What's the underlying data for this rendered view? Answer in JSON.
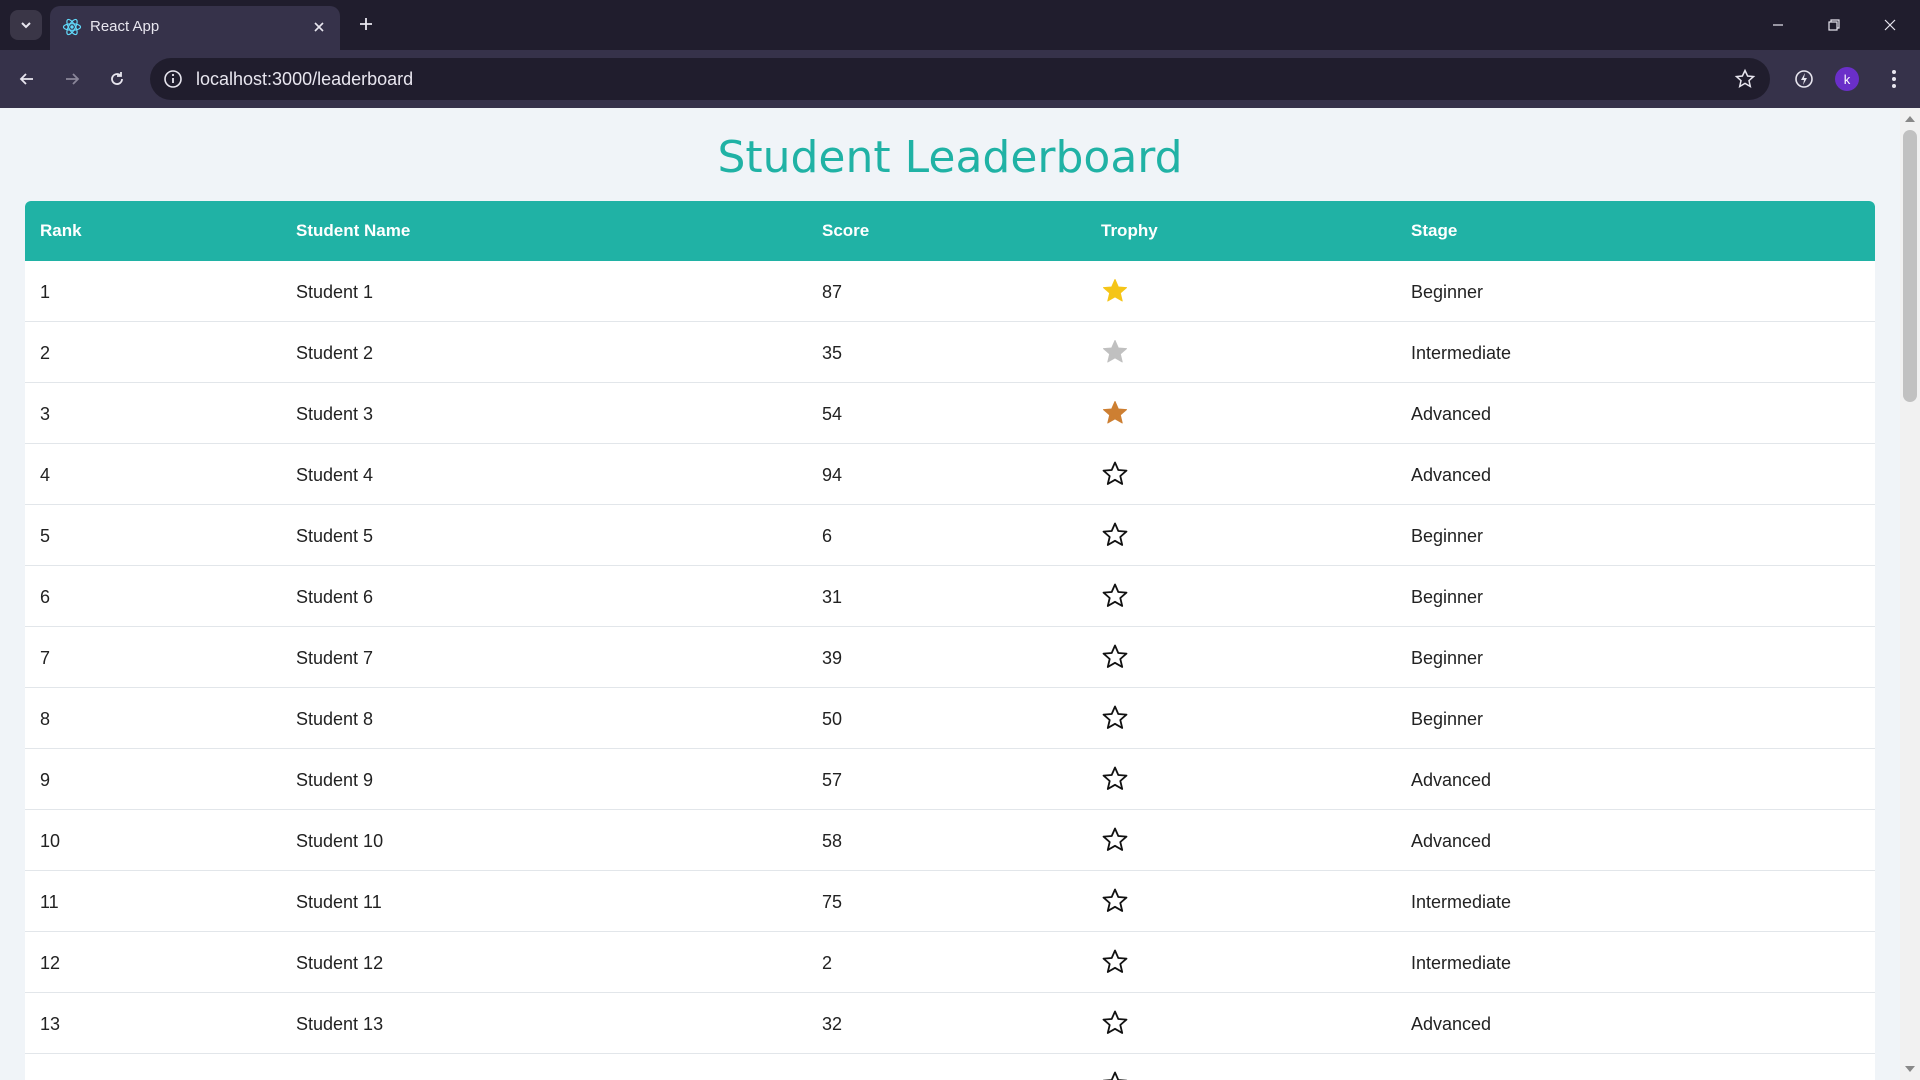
{
  "browser": {
    "tab_title": "React App",
    "url": "localhost:3000/leaderboard",
    "profile_initial": "k"
  },
  "page": {
    "title": "Student Leaderboard"
  },
  "table": {
    "columns": [
      "Rank",
      "Student Name",
      "Score",
      "Trophy",
      "Stage"
    ],
    "rows": [
      {
        "rank": "1",
        "name": "Student 1",
        "score": "87",
        "trophy": "gold-star",
        "stage": "Beginner"
      },
      {
        "rank": "2",
        "name": "Student 2",
        "score": "35",
        "trophy": "silver-star",
        "stage": "Intermediate"
      },
      {
        "rank": "3",
        "name": "Student 3",
        "score": "54",
        "trophy": "bronze-star",
        "stage": "Advanced"
      },
      {
        "rank": "4",
        "name": "Student 4",
        "score": "94",
        "trophy": "outline-star",
        "stage": "Advanced"
      },
      {
        "rank": "5",
        "name": "Student 5",
        "score": "6",
        "trophy": "outline-star",
        "stage": "Beginner"
      },
      {
        "rank": "6",
        "name": "Student 6",
        "score": "31",
        "trophy": "outline-star",
        "stage": "Beginner"
      },
      {
        "rank": "7",
        "name": "Student 7",
        "score": "39",
        "trophy": "outline-star",
        "stage": "Beginner"
      },
      {
        "rank": "8",
        "name": "Student 8",
        "score": "50",
        "trophy": "outline-star",
        "stage": "Beginner"
      },
      {
        "rank": "9",
        "name": "Student 9",
        "score": "57",
        "trophy": "outline-star",
        "stage": "Advanced"
      },
      {
        "rank": "10",
        "name": "Student 10",
        "score": "58",
        "trophy": "outline-star",
        "stage": "Advanced"
      },
      {
        "rank": "11",
        "name": "Student 11",
        "score": "75",
        "trophy": "outline-star",
        "stage": "Intermediate"
      },
      {
        "rank": "12",
        "name": "Student 12",
        "score": "2",
        "trophy": "outline-star",
        "stage": "Intermediate"
      },
      {
        "rank": "13",
        "name": "Student 13",
        "score": "32",
        "trophy": "outline-star",
        "stage": "Advanced"
      },
      {
        "rank": "",
        "name": "",
        "score": "",
        "trophy": "outline-star",
        "stage": ""
      }
    ]
  },
  "colors": {
    "accent": "#20b2a5",
    "gold": "#f5c518",
    "silver": "#c0c0c0",
    "bronze": "#cd7f32"
  }
}
